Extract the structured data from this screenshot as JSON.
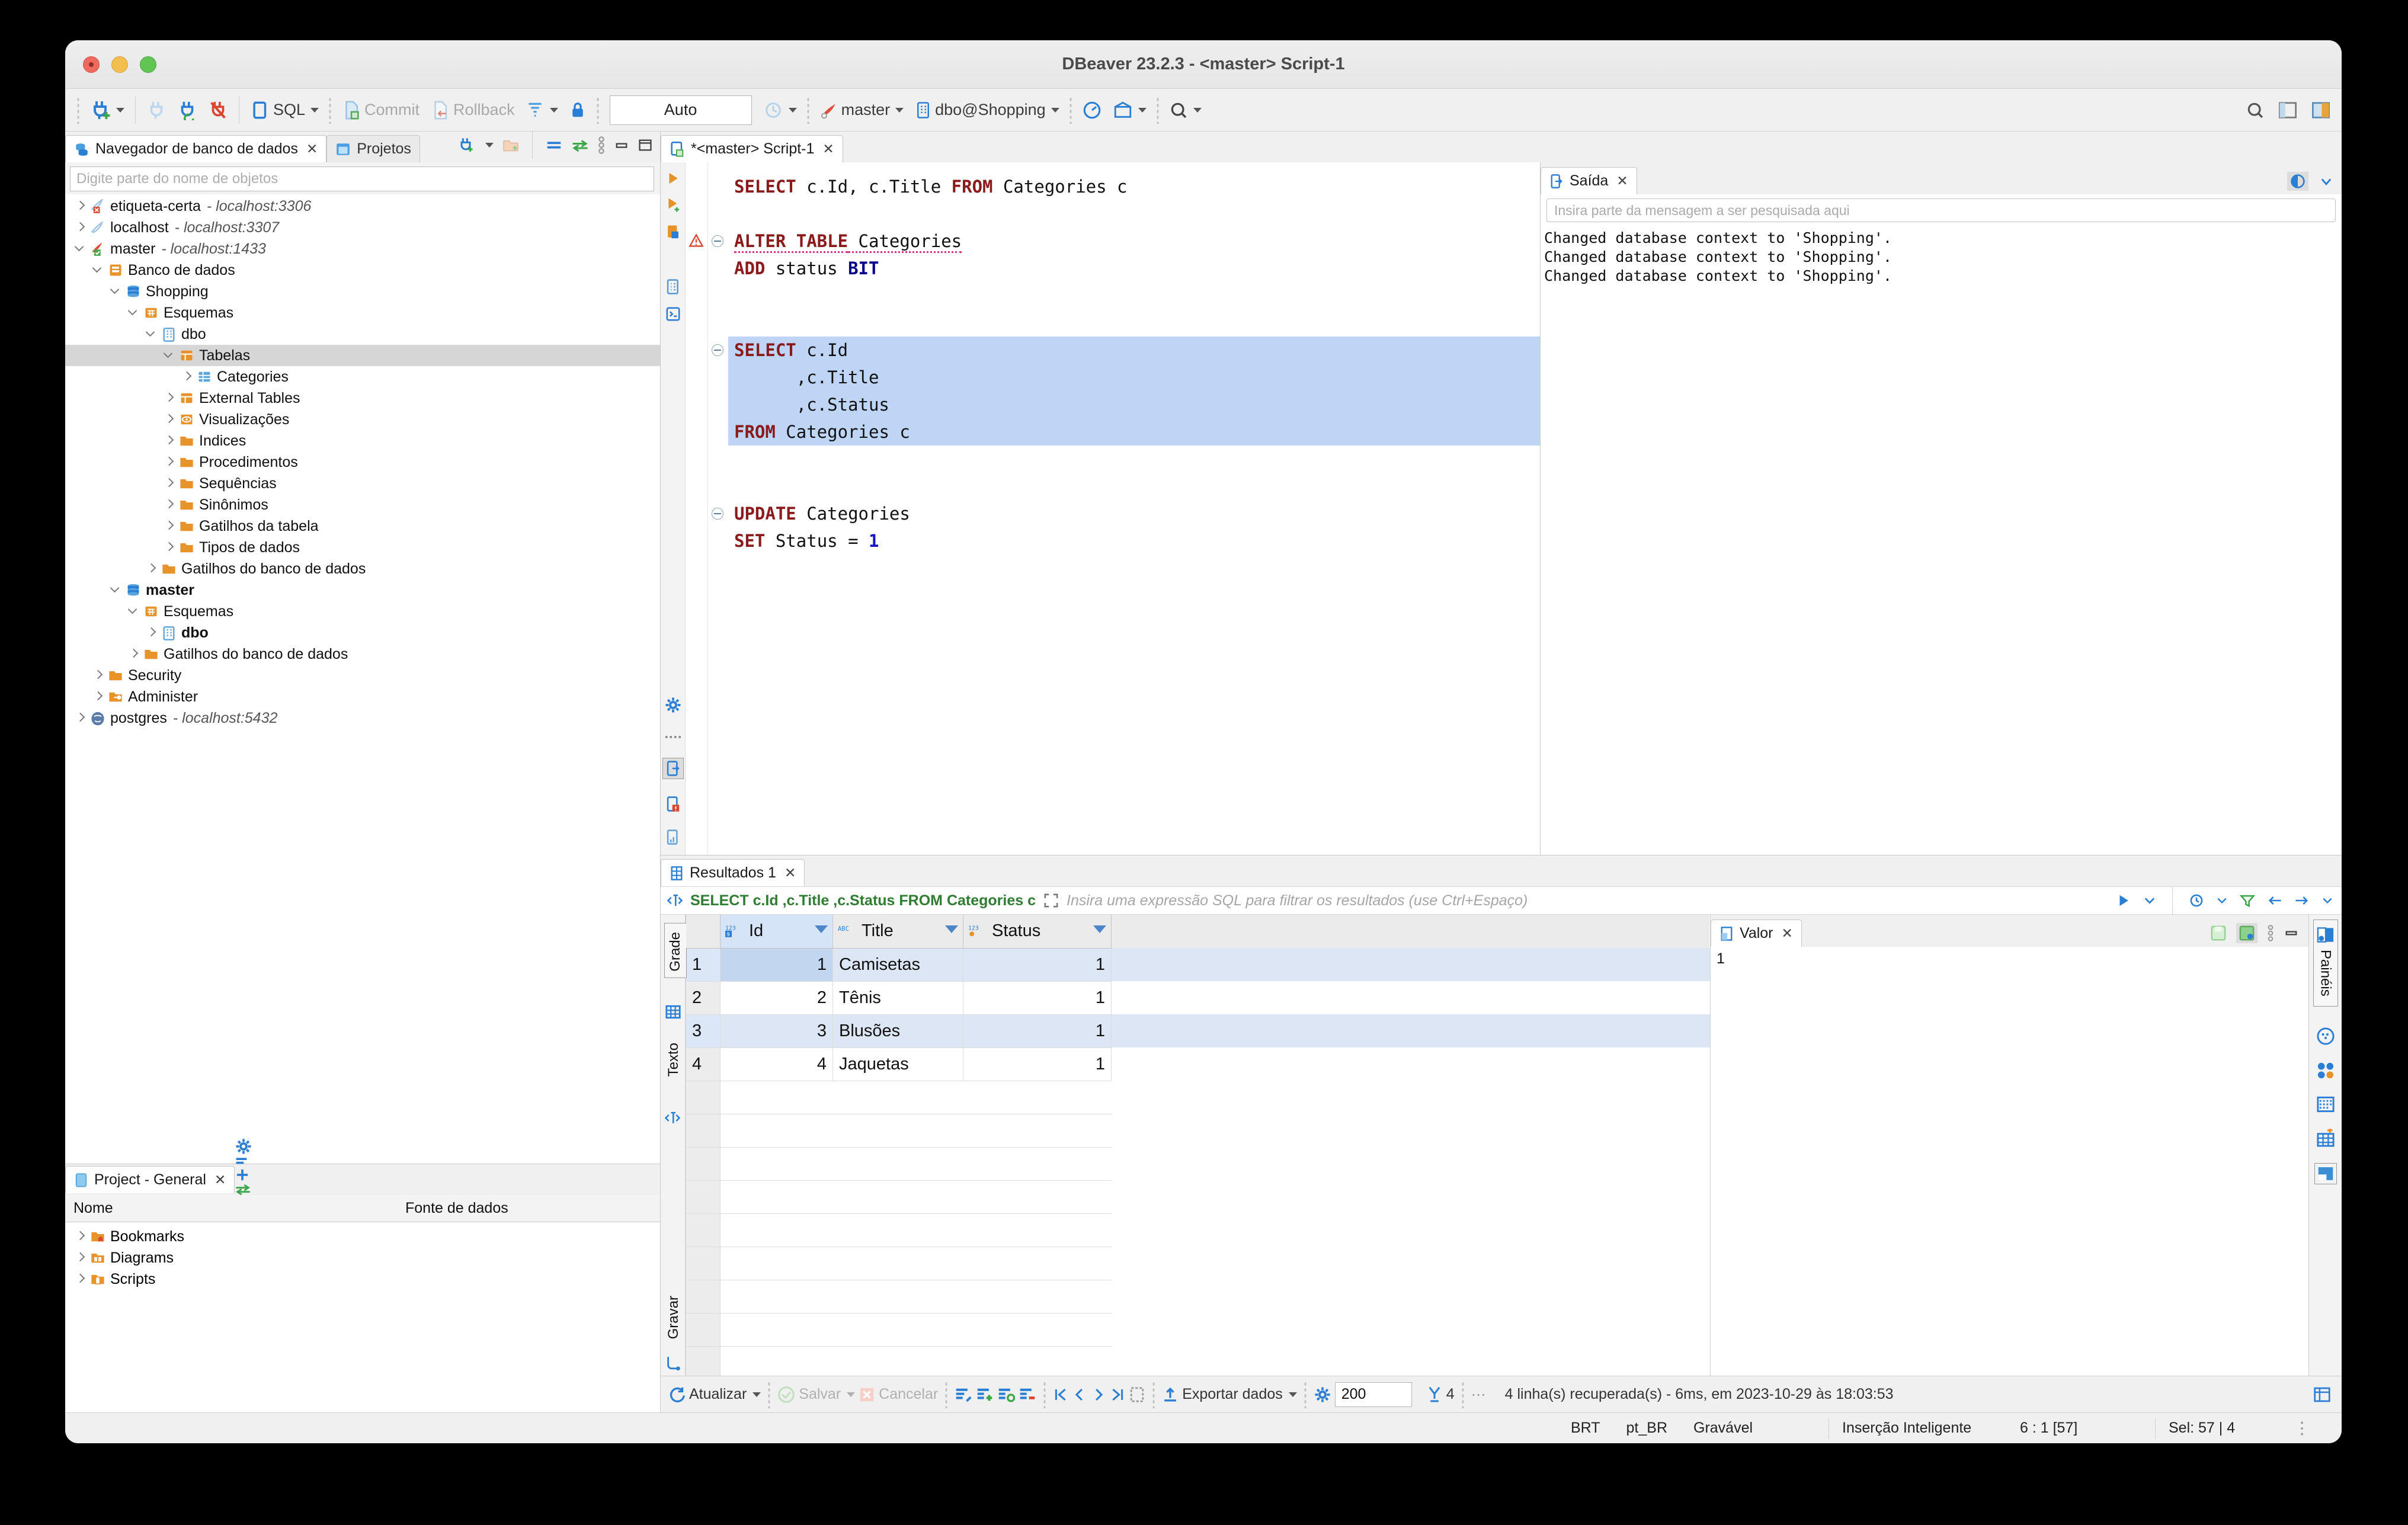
{
  "window": {
    "title": "DBeaver 23.2.3 - <master> Script-1"
  },
  "toolbar": {
    "sql_label": "SQL",
    "commit_label": "Commit",
    "rollback_label": "Rollback",
    "auto_label": "Auto",
    "connection_label": "master",
    "schema_label": "dbo@Shopping"
  },
  "navigator": {
    "tab_label": "Navegador de banco de dados",
    "tab2_label": "Projetos",
    "search_placeholder": "Digite parte do nome de objetos",
    "tree": [
      {
        "label": "etiqueta-certa",
        "suffix": "- localhost:3306",
        "icon": "connection-error-icon",
        "depth": 0,
        "arrow": "right",
        "bold": false,
        "selected": false
      },
      {
        "label": "localhost",
        "suffix": "- localhost:3307",
        "icon": "connection-icon",
        "depth": 0,
        "arrow": "right",
        "bold": false,
        "selected": false
      },
      {
        "label": "master",
        "suffix": "- localhost:1433",
        "icon": "connection-ok-icon",
        "depth": 0,
        "arrow": "down",
        "bold": false,
        "selected": false
      },
      {
        "label": "Banco de dados",
        "suffix": "",
        "icon": "database-folder-icon",
        "depth": 1,
        "arrow": "down",
        "bold": false,
        "selected": false
      },
      {
        "label": "Shopping",
        "suffix": "",
        "icon": "database-icon",
        "depth": 2,
        "arrow": "down",
        "bold": false,
        "selected": false
      },
      {
        "label": "Esquemas",
        "suffix": "",
        "icon": "schemas-folder-icon",
        "depth": 3,
        "arrow": "down",
        "bold": false,
        "selected": false
      },
      {
        "label": "dbo",
        "suffix": "",
        "icon": "schema-icon",
        "depth": 4,
        "arrow": "down",
        "bold": false,
        "selected": false
      },
      {
        "label": "Tabelas",
        "suffix": "",
        "icon": "tables-folder-icon",
        "depth": 5,
        "arrow": "down",
        "bold": false,
        "selected": true
      },
      {
        "label": "Categories",
        "suffix": "",
        "icon": "table-icon",
        "depth": 6,
        "arrow": "right",
        "bold": false,
        "selected": false
      },
      {
        "label": "External Tables",
        "suffix": "",
        "icon": "tables-folder-icon",
        "depth": 5,
        "arrow": "right",
        "bold": false,
        "selected": false
      },
      {
        "label": "Visualizações",
        "suffix": "",
        "icon": "views-folder-icon",
        "depth": 5,
        "arrow": "right",
        "bold": false,
        "selected": false
      },
      {
        "label": "Indices",
        "suffix": "",
        "icon": "folder-icon",
        "depth": 5,
        "arrow": "right",
        "bold": false,
        "selected": false
      },
      {
        "label": "Procedimentos",
        "suffix": "",
        "icon": "folder-icon",
        "depth": 5,
        "arrow": "right",
        "bold": false,
        "selected": false
      },
      {
        "label": "Sequências",
        "suffix": "",
        "icon": "folder-icon",
        "depth": 5,
        "arrow": "right",
        "bold": false,
        "selected": false
      },
      {
        "label": "Sinônimos",
        "suffix": "",
        "icon": "folder-icon",
        "depth": 5,
        "arrow": "right",
        "bold": false,
        "selected": false
      },
      {
        "label": "Gatilhos da tabela",
        "suffix": "",
        "icon": "folder-icon",
        "depth": 5,
        "arrow": "right",
        "bold": false,
        "selected": false
      },
      {
        "label": "Tipos de dados",
        "suffix": "",
        "icon": "folder-icon",
        "depth": 5,
        "arrow": "right",
        "bold": false,
        "selected": false
      },
      {
        "label": "Gatilhos do banco de dados",
        "suffix": "",
        "icon": "folder-icon",
        "depth": 4,
        "arrow": "right",
        "bold": false,
        "selected": false
      },
      {
        "label": "master",
        "suffix": "",
        "icon": "database-icon",
        "depth": 2,
        "arrow": "down",
        "bold": true,
        "selected": false
      },
      {
        "label": "Esquemas",
        "suffix": "",
        "icon": "schemas-folder-icon",
        "depth": 3,
        "arrow": "down",
        "bold": false,
        "selected": false
      },
      {
        "label": "dbo",
        "suffix": "",
        "icon": "schema-icon",
        "depth": 4,
        "arrow": "right",
        "bold": true,
        "selected": false
      },
      {
        "label": "Gatilhos do banco de dados",
        "suffix": "",
        "icon": "folder-icon",
        "depth": 3,
        "arrow": "right",
        "bold": false,
        "selected": false
      },
      {
        "label": "Security",
        "suffix": "",
        "icon": "folder-icon",
        "depth": 1,
        "arrow": "right",
        "bold": false,
        "selected": false
      },
      {
        "label": "Administer",
        "suffix": "",
        "icon": "admin-folder-icon",
        "depth": 1,
        "arrow": "right",
        "bold": false,
        "selected": false
      },
      {
        "label": "postgres",
        "suffix": "- localhost:5432",
        "icon": "postgres-icon",
        "depth": 0,
        "arrow": "right",
        "bold": false,
        "selected": false
      }
    ]
  },
  "project_panel": {
    "tab_label": "Project - General",
    "col_name": "Nome",
    "col_datasource": "Fonte de dados",
    "items": [
      {
        "label": "Bookmarks",
        "icon": "bookmarks-folder-icon"
      },
      {
        "label": "Diagrams",
        "icon": "diagrams-folder-icon"
      },
      {
        "label": "Scripts",
        "icon": "scripts-folder-icon"
      }
    ]
  },
  "editor": {
    "tab_label": "*<master> Script-1",
    "lines": [
      {
        "id": "l1",
        "indent": 0,
        "highlight": false,
        "fold": false,
        "tokens": [
          {
            "t": "SELECT",
            "c": "kw"
          },
          {
            "t": " c.Id, c.Title ",
            "c": "plain"
          },
          {
            "t": "FROM",
            "c": "kw"
          },
          {
            "t": " Categories c",
            "c": "plain"
          }
        ]
      },
      {
        "id": "l2",
        "indent": 0,
        "highlight": false,
        "fold": false,
        "tokens": []
      },
      {
        "id": "l3",
        "indent": 0,
        "highlight": false,
        "fold": true,
        "tokens": [
          {
            "t": "ALTER TABLE",
            "c": "kw err"
          },
          {
            "t": " Categories",
            "c": "plain err"
          }
        ]
      },
      {
        "id": "l4",
        "indent": 0,
        "highlight": false,
        "fold": false,
        "tokens": [
          {
            "t": "ADD",
            "c": "kw"
          },
          {
            "t": " status ",
            "c": "plain"
          },
          {
            "t": "BIT",
            "c": "kw2"
          }
        ]
      },
      {
        "id": "l5",
        "indent": 0,
        "highlight": false,
        "fold": false,
        "tokens": []
      },
      {
        "id": "l6",
        "indent": 0,
        "highlight": false,
        "fold": false,
        "tokens": []
      },
      {
        "id": "l7",
        "indent": 0,
        "highlight": true,
        "fold": true,
        "tokens": [
          {
            "t": "SELECT",
            "c": "kw"
          },
          {
            "t": " c.Id",
            "c": "plain"
          }
        ]
      },
      {
        "id": "l8",
        "indent": 0,
        "highlight": true,
        "fold": false,
        "tokens": [
          {
            "t": "      ,c.Title",
            "c": "plain"
          }
        ]
      },
      {
        "id": "l9",
        "indent": 0,
        "highlight": true,
        "fold": false,
        "tokens": [
          {
            "t": "      ,c.Status",
            "c": "plain"
          }
        ]
      },
      {
        "id": "l10",
        "indent": 0,
        "highlight": true,
        "fold": false,
        "tokens": [
          {
            "t": "FROM",
            "c": "kw"
          },
          {
            "t": " Categories c",
            "c": "plain"
          }
        ]
      },
      {
        "id": "l11",
        "indent": 0,
        "highlight": false,
        "fold": false,
        "tokens": []
      },
      {
        "id": "l12",
        "indent": 0,
        "highlight": false,
        "fold": false,
        "tokens": []
      },
      {
        "id": "l13",
        "indent": 0,
        "highlight": false,
        "fold": true,
        "tokens": [
          {
            "t": "UPDATE",
            "c": "kw"
          },
          {
            "t": " Categories",
            "c": "plain"
          }
        ]
      },
      {
        "id": "l14",
        "indent": 0,
        "highlight": false,
        "fold": false,
        "tokens": [
          {
            "t": "SET",
            "c": "kw"
          },
          {
            "t": " Status = ",
            "c": "plain"
          },
          {
            "t": "1",
            "c": "num"
          }
        ]
      }
    ]
  },
  "output": {
    "tab_label": "Saída",
    "search_placeholder": "Insira parte da mensagem a ser pesquisada aqui",
    "log": [
      "Changed database context to 'Shopping'.",
      "Changed database context to 'Shopping'.",
      "Changed database context to 'Shopping'."
    ]
  },
  "results": {
    "tab_label": "Resultados 1",
    "query_text": "SELECT c.Id ,c.Title ,c.Status FROM Categories c",
    "filter_placeholder": "Insira uma expressão SQL para filtrar os resultados (use Ctrl+Espaço)",
    "side_tabs": [
      "Grade",
      "Texto",
      "Gravar"
    ],
    "columns": [
      {
        "label": "Id",
        "type_icon": "number-key-icon",
        "is_key": true,
        "align": "right"
      },
      {
        "label": "Title",
        "type_icon": "text-icon",
        "is_key": false,
        "align": "left"
      },
      {
        "label": "Status",
        "type_icon": "number-icon",
        "is_key": false,
        "align": "right"
      }
    ],
    "rows": [
      {
        "n": "1",
        "cells": [
          "1",
          "Camisetas",
          "1"
        ],
        "selected": true
      },
      {
        "n": "2",
        "cells": [
          "2",
          "Tênis",
          "1"
        ],
        "selected": false
      },
      {
        "n": "3",
        "cells": [
          "3",
          "Blusões",
          "1"
        ],
        "selected": true
      },
      {
        "n": "4",
        "cells": [
          "4",
          "Jaquetas",
          "1"
        ],
        "selected": false
      }
    ],
    "empty_row_count": 11,
    "bottom_toolbar": {
      "refresh_label": "Atualizar",
      "save_label": "Salvar",
      "cancel_label": "Cancelar",
      "export_label": "Exportar dados",
      "fetch_size": "200",
      "row_badge": "4",
      "status_text": "4 linha(s) recuperada(s) - 6ms, em 2023-10-29 às 18:03:53"
    }
  },
  "value_panel": {
    "tab_label": "Valor",
    "value": "1",
    "rail_label": "Painéis"
  },
  "statusbar": {
    "timezone": "BRT",
    "locale": "pt_BR",
    "writable": "Gravável",
    "insert_mode": "Inserção Inteligente",
    "caret": "6 : 1 [57]",
    "selection": "Sel: 57 | 4"
  },
  "colors": {
    "accent_blue": "#2a7fd4",
    "keyword_red": "#8b1a1a",
    "type_blue": "#00008b",
    "number_blue": "#1414c8",
    "selection_blue": "#bed5f5",
    "folder_orange": "#e8922a",
    "query_green": "#2e7d32"
  }
}
